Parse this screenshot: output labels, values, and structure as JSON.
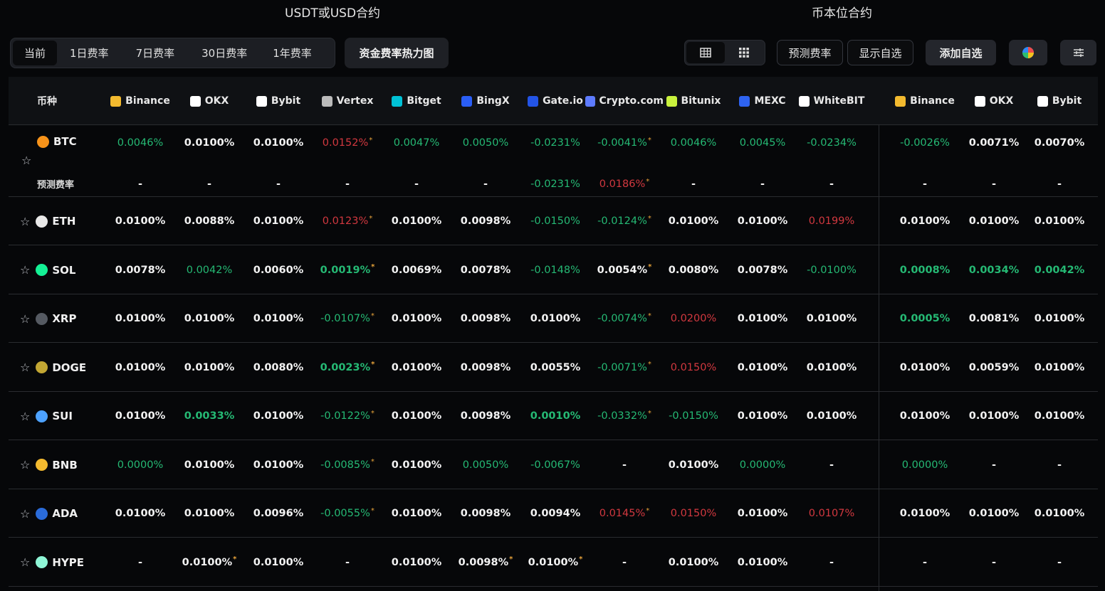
{
  "titles": {
    "usdt": "USDT或USD合约",
    "coin": "币本位合约"
  },
  "tabs": [
    {
      "label": "当前",
      "active": true
    },
    {
      "label": "1日费率",
      "active": false
    },
    {
      "label": "7日费率",
      "active": false
    },
    {
      "label": "30日费率",
      "active": false
    },
    {
      "label": "1年费率",
      "active": false
    }
  ],
  "heatmap_label": "资金费率热力图",
  "view_toggle": {
    "options": [
      "table-icon",
      "grid-icon"
    ],
    "active": "table-icon"
  },
  "buttons": {
    "predict": "预测费率",
    "show_favorites": "显示自选",
    "add_favorite": "添加自选",
    "color": "palette-icon",
    "settings": "sliders-icon"
  },
  "columns": {
    "coin_label": "币种",
    "usdt": [
      "Binance",
      "OKX",
      "Bybit",
      "Vertex",
      "Bitget",
      "BingX",
      "Gate.io",
      "Crypto.com",
      "Bitunix",
      "MEXC",
      "WhiteBIT"
    ],
    "coin_margined": [
      "Binance",
      "OKX",
      "Bybit"
    ]
  },
  "colors": {
    "green": "#25b974",
    "red": "#d2383f",
    "asterisk": "#e8a33a",
    "background": "#060709"
  },
  "predict_label": "预测费率",
  "rows": [
    {
      "coin": "BTC",
      "icon_color": "#f7931a",
      "values": [
        [
          "0.0046%",
          "g"
        ],
        [
          "0.0100%",
          "w"
        ],
        [
          "0.0100%",
          "w"
        ],
        [
          "0.0152%",
          "r*"
        ],
        [
          "0.0047%",
          "g"
        ],
        [
          "0.0050%",
          "g"
        ],
        [
          "-0.0231%",
          "g"
        ],
        [
          "-0.0041%",
          "g*"
        ],
        [
          "0.0046%",
          "g"
        ],
        [
          "0.0045%",
          "g"
        ],
        [
          "-0.0234%",
          "g"
        ],
        [
          "-0.0026%",
          "g"
        ],
        [
          "0.0071%",
          "w"
        ],
        [
          "0.0070%",
          "w"
        ]
      ],
      "predicted": [
        [
          "-",
          "w"
        ],
        [
          "-",
          "w"
        ],
        [
          "-",
          "w"
        ],
        [
          "-",
          "w"
        ],
        [
          "-",
          "w"
        ],
        [
          "-",
          "w"
        ],
        [
          "-0.0231%",
          "g"
        ],
        [
          "0.0186%",
          "r*"
        ],
        [
          "-",
          "w"
        ],
        [
          "-",
          "w"
        ],
        [
          "-",
          "w"
        ],
        [
          "-",
          "w"
        ],
        [
          "-",
          "w"
        ],
        [
          "-",
          "w"
        ]
      ]
    },
    {
      "coin": "ETH",
      "icon_color": "#e8e8e8",
      "values": [
        [
          "0.0100%",
          "w"
        ],
        [
          "0.0088%",
          "w"
        ],
        [
          "0.0100%",
          "w"
        ],
        [
          "0.0123%",
          "r*"
        ],
        [
          "0.0100%",
          "w"
        ],
        [
          "0.0098%",
          "w"
        ],
        [
          "-0.0150%",
          "g"
        ],
        [
          "-0.0124%",
          "g*"
        ],
        [
          "0.0100%",
          "w"
        ],
        [
          "0.0100%",
          "w"
        ],
        [
          "0.0199%",
          "r"
        ],
        [
          "0.0100%",
          "w"
        ],
        [
          "0.0100%",
          "w"
        ],
        [
          "0.0100%",
          "w"
        ]
      ]
    },
    {
      "coin": "SOL",
      "icon_color": "#14f195",
      "values": [
        [
          "0.0078%",
          "w"
        ],
        [
          "0.0042%",
          "g"
        ],
        [
          "0.0060%",
          "w"
        ],
        [
          "0.0019%",
          "G*"
        ],
        [
          "0.0069%",
          "w"
        ],
        [
          "0.0078%",
          "w"
        ],
        [
          "-0.0148%",
          "g"
        ],
        [
          "0.0054%",
          "w*"
        ],
        [
          "0.0080%",
          "w"
        ],
        [
          "0.0078%",
          "w"
        ],
        [
          "-0.0100%",
          "g"
        ],
        [
          "0.0008%",
          "G"
        ],
        [
          "0.0034%",
          "G"
        ],
        [
          "0.0042%",
          "G"
        ]
      ]
    },
    {
      "coin": "XRP",
      "icon_color": "#555a62",
      "values": [
        [
          "0.0100%",
          "w"
        ],
        [
          "0.0100%",
          "w"
        ],
        [
          "0.0100%",
          "w"
        ],
        [
          "-0.0107%",
          "g*"
        ],
        [
          "0.0100%",
          "w"
        ],
        [
          "0.0098%",
          "w"
        ],
        [
          "0.0100%",
          "w"
        ],
        [
          "-0.0074%",
          "g*"
        ],
        [
          "0.0200%",
          "r"
        ],
        [
          "0.0100%",
          "w"
        ],
        [
          "0.0100%",
          "w"
        ],
        [
          "0.0005%",
          "G"
        ],
        [
          "0.0081%",
          "w"
        ],
        [
          "0.0100%",
          "w"
        ]
      ]
    },
    {
      "coin": "DOGE",
      "icon_color": "#c2a633",
      "values": [
        [
          "0.0100%",
          "w"
        ],
        [
          "0.0100%",
          "w"
        ],
        [
          "0.0080%",
          "w"
        ],
        [
          "0.0023%",
          "G*"
        ],
        [
          "0.0100%",
          "w"
        ],
        [
          "0.0098%",
          "w"
        ],
        [
          "0.0055%",
          "w"
        ],
        [
          "-0.0071%",
          "g*"
        ],
        [
          "0.0150%",
          "r"
        ],
        [
          "0.0100%",
          "w"
        ],
        [
          "0.0100%",
          "w"
        ],
        [
          "0.0100%",
          "w"
        ],
        [
          "0.0059%",
          "w"
        ],
        [
          "0.0100%",
          "w"
        ]
      ]
    },
    {
      "coin": "SUI",
      "icon_color": "#4da2ff",
      "values": [
        [
          "0.0100%",
          "w"
        ],
        [
          "0.0033%",
          "G"
        ],
        [
          "0.0100%",
          "w"
        ],
        [
          "-0.0122%",
          "g*"
        ],
        [
          "0.0100%",
          "w"
        ],
        [
          "0.0098%",
          "w"
        ],
        [
          "0.0010%",
          "G"
        ],
        [
          "-0.0332%",
          "g*"
        ],
        [
          "-0.0150%",
          "g"
        ],
        [
          "0.0100%",
          "w"
        ],
        [
          "0.0100%",
          "w"
        ],
        [
          "0.0100%",
          "w"
        ],
        [
          "0.0100%",
          "w"
        ],
        [
          "0.0100%",
          "w"
        ]
      ]
    },
    {
      "coin": "BNB",
      "icon_color": "#f3ba2f",
      "values": [
        [
          "0.0000%",
          "g"
        ],
        [
          "0.0100%",
          "w"
        ],
        [
          "0.0100%",
          "w"
        ],
        [
          "-0.0085%",
          "g*"
        ],
        [
          "0.0100%",
          "w"
        ],
        [
          "0.0050%",
          "g"
        ],
        [
          "-0.0067%",
          "g"
        ],
        [
          "-",
          "w"
        ],
        [
          "0.0100%",
          "w"
        ],
        [
          "0.0000%",
          "g"
        ],
        [
          "-",
          "w"
        ],
        [
          "0.0000%",
          "g"
        ],
        [
          "-",
          "w"
        ],
        [
          "-",
          "w"
        ]
      ]
    },
    {
      "coin": "ADA",
      "icon_color": "#2a6bd9",
      "values": [
        [
          "0.0100%",
          "w"
        ],
        [
          "0.0100%",
          "w"
        ],
        [
          "0.0096%",
          "w"
        ],
        [
          "-0.0055%",
          "g*"
        ],
        [
          "0.0100%",
          "w"
        ],
        [
          "0.0098%",
          "w"
        ],
        [
          "0.0094%",
          "w"
        ],
        [
          "0.0145%",
          "r*"
        ],
        [
          "0.0150%",
          "r"
        ],
        [
          "0.0100%",
          "w"
        ],
        [
          "0.0107%",
          "r"
        ],
        [
          "0.0100%",
          "w"
        ],
        [
          "0.0100%",
          "w"
        ],
        [
          "0.0100%",
          "w"
        ]
      ]
    },
    {
      "coin": "HYPE",
      "icon_color": "#8ef5d6",
      "values": [
        [
          "-",
          "w"
        ],
        [
          "0.0100%",
          "w*"
        ],
        [
          "0.0100%",
          "w"
        ],
        [
          "-",
          "w"
        ],
        [
          "0.0100%",
          "w"
        ],
        [
          "0.0098%",
          "w*"
        ],
        [
          "0.0100%",
          "w*"
        ],
        [
          "-",
          "w"
        ],
        [
          "0.0100%",
          "w"
        ],
        [
          "0.0100%",
          "w"
        ],
        [
          "-",
          "w"
        ],
        [
          "-",
          "w"
        ],
        [
          "-",
          "w"
        ],
        [
          "-",
          "w"
        ]
      ]
    }
  ]
}
